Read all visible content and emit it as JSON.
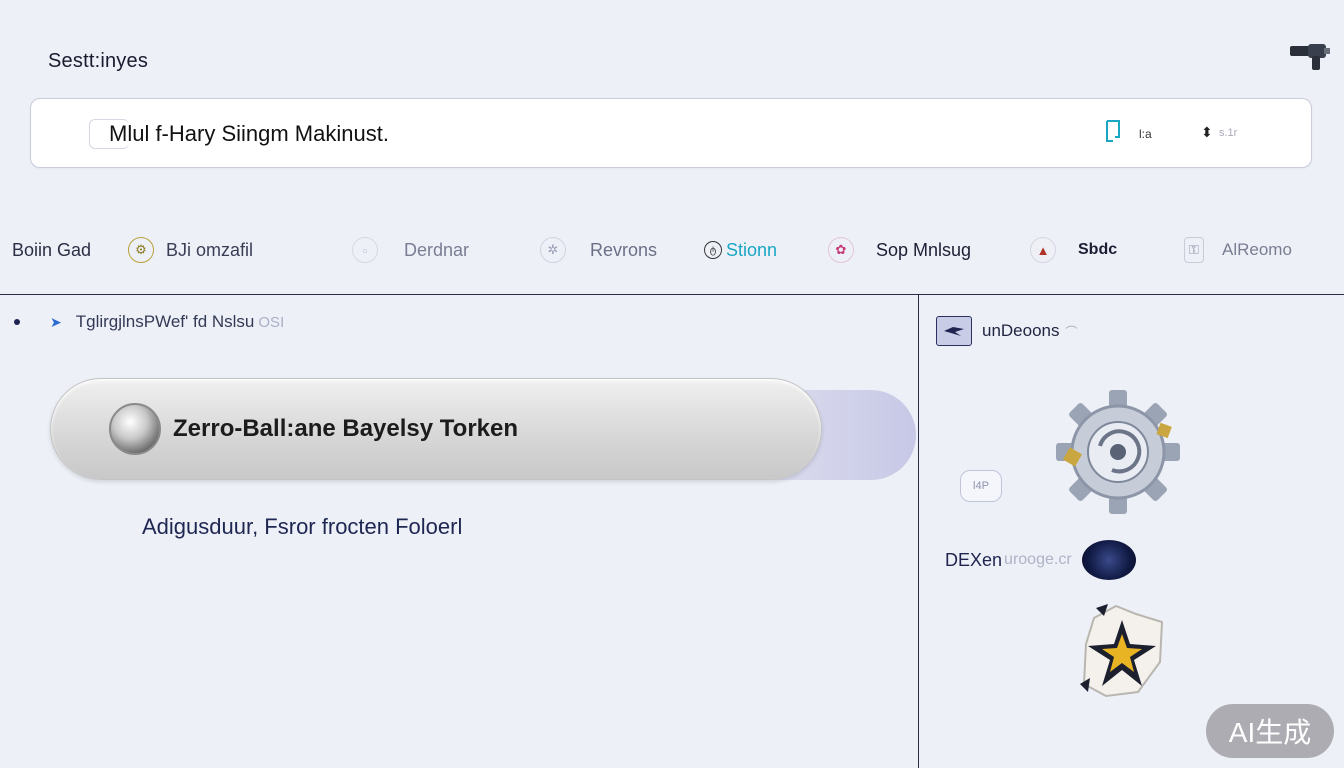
{
  "header": {
    "title": "Sestt:inyes"
  },
  "search": {
    "text": "Mlul f-Hary Siingm Makinust.",
    "filter_label": "l:a",
    "sort_label": "s.1r"
  },
  "tabs": [
    {
      "label": "Boiin Gad",
      "icon": "home-icon"
    },
    {
      "label": "BJi omzafil",
      "icon": "settings-icon"
    },
    {
      "label": "Derdnar",
      "icon": "calendar-icon"
    },
    {
      "label": "Revrons",
      "icon": "gear-icon"
    },
    {
      "label": "Stionn",
      "icon": "link-icon"
    },
    {
      "label": "Sop Mnlsug",
      "icon": "tag-icon"
    },
    {
      "label": "Sbdc",
      "icon": "shield-icon"
    },
    {
      "label": "AlReomo",
      "icon": "lock-icon"
    }
  ],
  "breadcrumb": {
    "text": "TglirgjlnsPWef' fd Nslsu",
    "suffix": "OSI"
  },
  "main": {
    "pill_label": "Zerro-Ball:ane Bayelsy Torken",
    "adjust_text": "Adigusduur,  Fsror frocten Foloerl"
  },
  "side": {
    "head_label": "unDeoons",
    "badge_text": "l4P",
    "dex_label": "DEXen",
    "dex_sub": "urooge.cr"
  },
  "watermark": "AI生成",
  "colors": {
    "background": "#eef0f8",
    "divider": "#2a2d4a",
    "accent_teal": "#1aa7c4",
    "navy": "#1e2752"
  }
}
